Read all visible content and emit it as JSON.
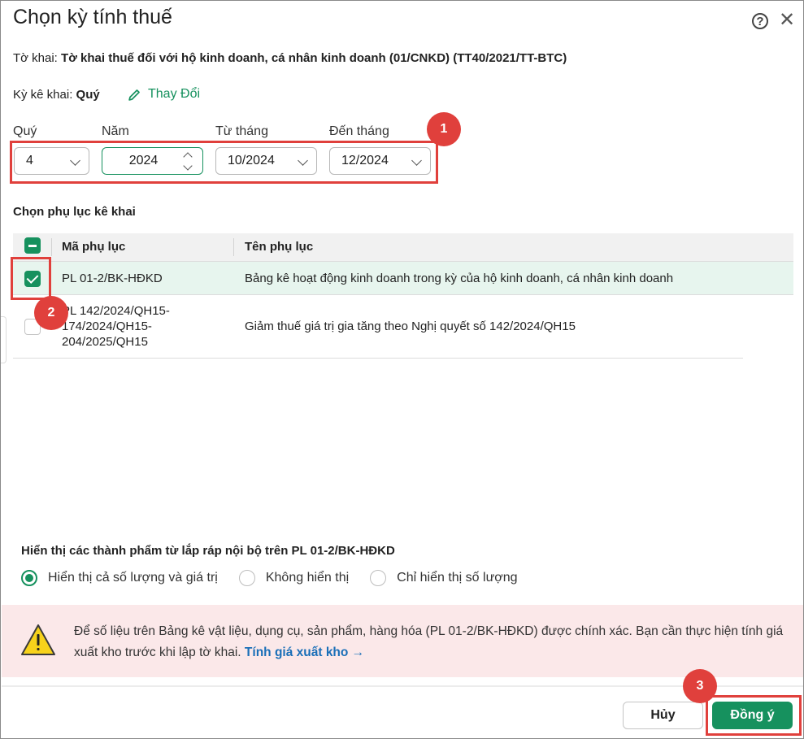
{
  "dialog": {
    "title": "Chọn kỳ tính thuế",
    "help_icon": "question-circle-icon",
    "close_icon": "close-icon"
  },
  "declaration": {
    "label": "Tờ khai:",
    "value": "Tờ khai thuế đối với hộ kinh doanh, cá nhân kinh doanh (01/CNKD) (TT40/2021/TT-BTC)"
  },
  "period": {
    "label": "Kỳ kê khai:",
    "value": "Quý",
    "change_label": "Thay Đổi"
  },
  "fields": {
    "quarter": {
      "label": "Quý",
      "value": "4"
    },
    "year": {
      "label": "Năm",
      "value": "2024"
    },
    "from_month": {
      "label": "Từ tháng",
      "value": "10/2024"
    },
    "to_month": {
      "label": "Đến tháng",
      "value": "12/2024"
    }
  },
  "appendix": {
    "title": "Chọn phụ lục kê khai",
    "columns": [
      "Mã phụ lục",
      "Tên phụ lục"
    ],
    "rows": [
      {
        "code": "PL 01-2/BK-HĐKD",
        "name": "Bảng kê hoạt động kinh doanh trong kỳ của hộ kinh doanh, cá nhân kinh doanh",
        "checked": true
      },
      {
        "code_lines": [
          "PL 142/2024/QH15-",
          "174/2024/QH15-",
          "204/2025/QH15"
        ],
        "name": "Giảm thuế giá trị gia tăng theo Nghị quyết số 142/2024/QH15",
        "checked": false
      }
    ]
  },
  "display": {
    "title": "Hiển thị các thành phẩm từ lắp ráp nội bộ trên PL 01-2/BK-HĐKD",
    "options": [
      "Hiển thị cả số lượng và giá trị",
      "Không hiển thị",
      "Chỉ hiển thị số lượng"
    ],
    "selected_index": 0
  },
  "warning": {
    "text": "Để số liệu trên Bảng kê vật liệu, dụng cụ, sản phẩm, hàng hóa (PL 01-2/BK-HĐKD) được chính xác. Bạn cần thực hiện tính giá xuất kho trước khi lập tờ khai.",
    "link": "Tính giá xuất kho →",
    "icon": "warning-triangle-icon"
  },
  "buttons": {
    "cancel": "Hủy",
    "ok": "Đồng ý"
  },
  "annotations": [
    "1",
    "2",
    "3"
  ],
  "colors": {
    "accent": "#16915e",
    "annotation": "#e0403c",
    "warning_bg": "#fbe8e9",
    "link": "#1a6fb8"
  }
}
